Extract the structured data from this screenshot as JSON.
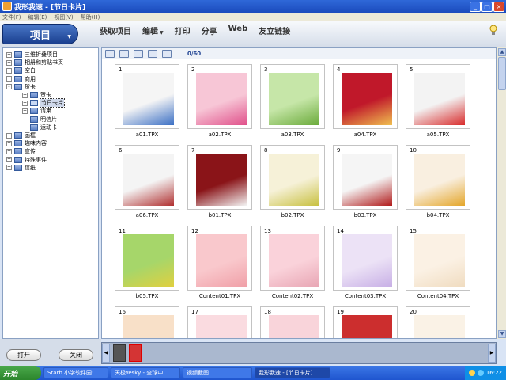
{
  "window": {
    "title": "我形我速 - [节日卡片]"
  },
  "menu": [
    "文件(F)",
    "编辑(E)",
    "视图(V)",
    "帮助(H)"
  ],
  "project_button": "项目",
  "top_nav": [
    {
      "label": "获取项目"
    },
    {
      "label": "编辑",
      "dropdown": true
    },
    {
      "label": "打印"
    },
    {
      "label": "分享"
    },
    {
      "label": "Web"
    },
    {
      "label": "友立链接"
    }
  ],
  "tree": [
    {
      "label": "三维折叠项目",
      "level": 0,
      "expander": "+"
    },
    {
      "label": "相册和剪贴书页",
      "level": 0,
      "expander": "+"
    },
    {
      "label": "空白",
      "level": 0,
      "expander": "+"
    },
    {
      "label": "商用",
      "level": 0,
      "expander": "+"
    },
    {
      "label": "贺卡",
      "level": 0,
      "expander": "-"
    },
    {
      "label": "贺卡",
      "level": 1,
      "expander": "+"
    },
    {
      "label": "节日卡片",
      "level": 1,
      "expander": "+",
      "selected": true
    },
    {
      "label": "请柬",
      "level": 1,
      "expander": "+"
    },
    {
      "label": "明信片",
      "level": 1,
      "expander": ""
    },
    {
      "label": "运动卡",
      "level": 1,
      "expander": ""
    },
    {
      "label": "画框",
      "level": 0,
      "expander": "+"
    },
    {
      "label": "趣味内容",
      "level": 0,
      "expander": "+"
    },
    {
      "label": "宣传",
      "level": 0,
      "expander": "+"
    },
    {
      "label": "特殊事件",
      "level": 0,
      "expander": "+"
    },
    {
      "label": "信纸",
      "level": 0,
      "expander": "+"
    }
  ],
  "counter": "0/60",
  "items": [
    {
      "num": "1",
      "name": "a01.TPX",
      "bg": "#f5f5f5",
      "accent": "#3a6fc4"
    },
    {
      "num": "2",
      "name": "a02.TPX",
      "bg": "#f7c6d6",
      "accent": "#e0508a"
    },
    {
      "num": "3",
      "name": "a03.TPX",
      "bg": "#c6e6a8",
      "accent": "#6aaa3a"
    },
    {
      "num": "4",
      "name": "a04.TPX",
      "bg": "#c0182a",
      "accent": "#f0c050"
    },
    {
      "num": "5",
      "name": "a05.TPX",
      "bg": "#f3f3f3",
      "accent": "#d82a2a"
    },
    {
      "num": "6",
      "name": "a06.TPX",
      "bg": "#f4f4f4",
      "accent": "#b03030"
    },
    {
      "num": "7",
      "name": "b01.TPX",
      "bg": "#8a1418",
      "accent": "#f3f3f3"
    },
    {
      "num": "8",
      "name": "b02.TPX",
      "bg": "#f6f1d8",
      "accent": "#c8c040"
    },
    {
      "num": "9",
      "name": "b03.TPX",
      "bg": "#f5f5f5",
      "accent": "#b01a1a"
    },
    {
      "num": "10",
      "name": "b04.TPX",
      "bg": "#f9efe0",
      "accent": "#e4a62a"
    },
    {
      "num": "11",
      "name": "b05.TPX",
      "bg": "#a6d66a",
      "accent": "#e0d040"
    },
    {
      "num": "12",
      "name": "Content01.TPX",
      "bg": "#f9c8cc",
      "accent": "#f0a0a8"
    },
    {
      "num": "13",
      "name": "Content02.TPX",
      "bg": "#fad2da",
      "accent": "#e8a6b4"
    },
    {
      "num": "14",
      "name": "Content03.TPX",
      "bg": "#ece2f6",
      "accent": "#c8b0e6"
    },
    {
      "num": "15",
      "name": "Content04.TPX",
      "bg": "#fbf1e4",
      "accent": "#f0dcc0"
    },
    {
      "num": "16",
      "name": "",
      "bg": "#f8e0c8",
      "accent": "#f0c090"
    },
    {
      "num": "17",
      "name": "",
      "bg": "#fadbe0",
      "accent": "#e8b0ba"
    },
    {
      "num": "18",
      "name": "",
      "bg": "#f9d4da",
      "accent": "#e6a4b0"
    },
    {
      "num": "19",
      "name": "",
      "bg": "#cc2e2e",
      "accent": "#e86060"
    },
    {
      "num": "20",
      "name": "",
      "bg": "#faf2e6",
      "accent": "#f0d8b8"
    }
  ],
  "buttons": {
    "open": "打开",
    "close": "关闭"
  },
  "taskbar": {
    "start": "开始",
    "items": [
      {
        "label": "Starb 小学软件园:..."
      },
      {
        "label": "天极Yesky - 全球中..."
      },
      {
        "label": "视频截图"
      },
      {
        "label": "我形我速 - [节日卡片]",
        "active": true
      }
    ],
    "clock": "16:22"
  }
}
